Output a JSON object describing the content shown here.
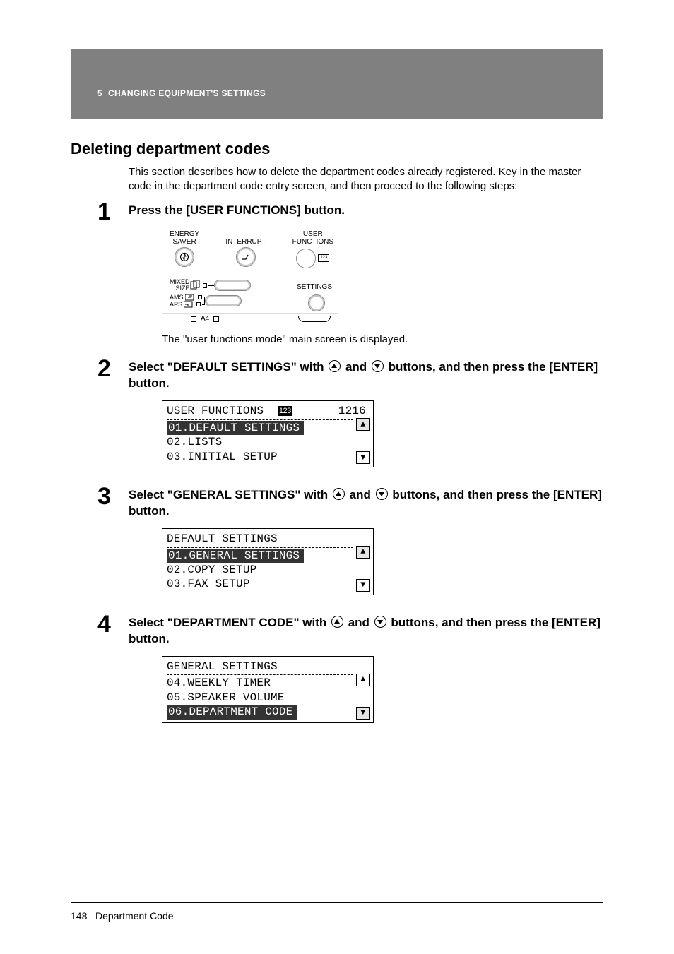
{
  "header": {
    "chapter_num": "5",
    "chapter_title": "CHANGING EQUIPMENT'S SETTINGS"
  },
  "section_title": "Deleting department codes",
  "intro": "This section describes how to delete the department codes already registered. Key in the master code in the department code entry screen, and then proceed to the following steps:",
  "step1": {
    "num": "1",
    "instr": "Press the [USER FUNCTIONS] button.",
    "panel": {
      "top": {
        "col1_l1": "ENERGY",
        "col1_l2": "SAVER",
        "col2_l1": "INTERRUPT",
        "col3_l1": "USER",
        "col3_l2": "FUNCTIONS"
      },
      "mid": {
        "r1_l1": "MIXED",
        "r1_l2": "SIZE",
        "r2a": "AMS",
        "r2b": "APS",
        "settings": "SETTINGS"
      },
      "bot": {
        "a4": "A4"
      }
    },
    "caption": "The \"user functions mode\" main screen is displayed."
  },
  "step2": {
    "num": "2",
    "instr_p1": "Select \"DEFAULT SETTINGS\" with ",
    "instr_p2": " and ",
    "instr_p3": " buttons, and then press the [ENTER] button.",
    "lcd": {
      "title": "USER FUNCTIONS",
      "badge": "123",
      "count": "1216",
      "row1": "01.DEFAULT SETTINGS",
      "row2": "02.LISTS",
      "row3": "03.INITIAL SETUP"
    }
  },
  "step3": {
    "num": "3",
    "instr_p1": "Select \"GENERAL SETTINGS\" with ",
    "instr_p2": " and ",
    "instr_p3": " buttons, and then press the [ENTER] button.",
    "lcd": {
      "title": "DEFAULT SETTINGS",
      "row1": "01.GENERAL SETTINGS",
      "row2": "02.COPY SETUP",
      "row3": "03.FAX SETUP"
    }
  },
  "step4": {
    "num": "4",
    "instr_p1": "Select \"DEPARTMENT CODE\" with ",
    "instr_p2": " and ",
    "instr_p3": " buttons, and then press the [ENTER] button.",
    "lcd": {
      "title": "GENERAL SETTINGS",
      "row1": "04.WEEKLY TIMER",
      "row2": "05.SPEAKER VOLUME",
      "row3": "06.DEPARTMENT CODE"
    }
  },
  "footer": {
    "pagenum": "148",
    "label": "Department Code"
  }
}
